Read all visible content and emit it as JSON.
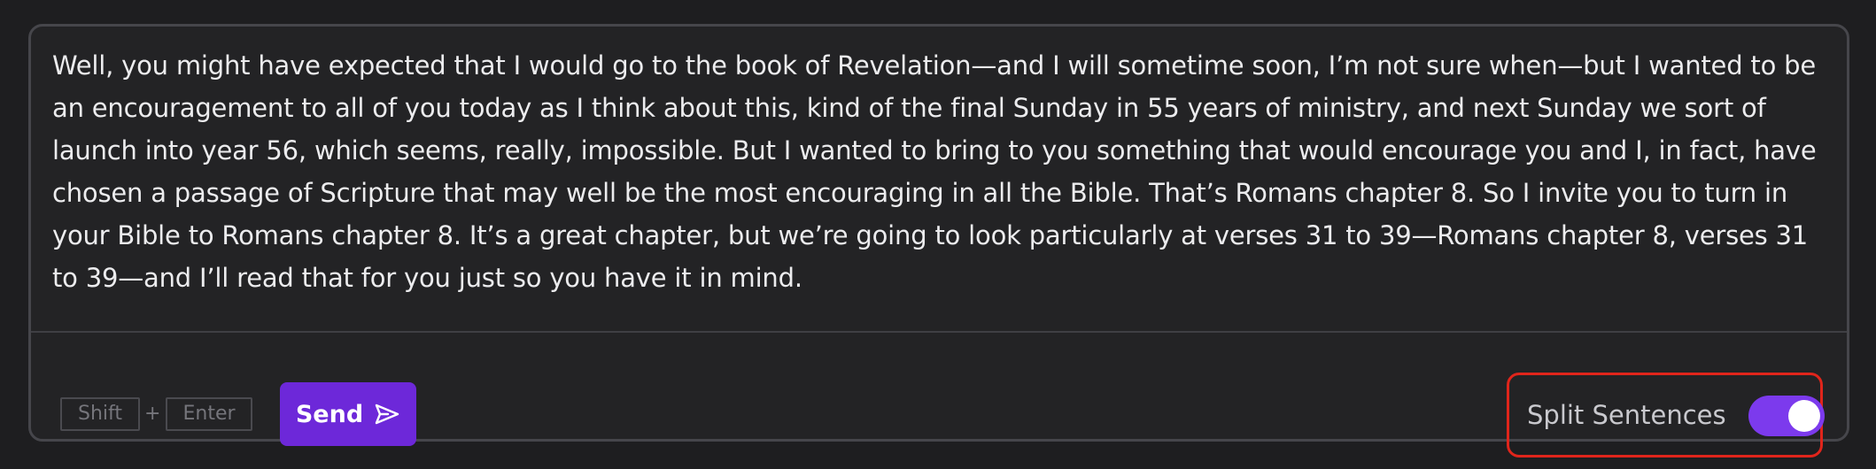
{
  "message": {
    "text": "Well, you might have expected that I would go to the book of Revelation—and I will sometime soon, I’m not sure when—but I wanted to be an encouragement to all of you today as I think about this, kind of the final Sunday in 55 years of ministry, and next Sunday we sort of launch into year 56, which seems, really, impossible. But I wanted to bring to you something that would encourage you and I, in fact, have chosen a passage of Scripture that may well be the most encouraging in all the Bible. That’s Romans chapter 8. So I invite you to turn in your Bible to Romans chapter 8. It’s a great chapter, but we’re going to look particularly at verses 31 to 39—Romans chapter 8, verses 31 to 39—and I’ll read that for you just so you have it in mind."
  },
  "shortcut": {
    "key1": "Shift",
    "plus": "+",
    "key2": "Enter"
  },
  "send": {
    "label": "Send",
    "icon": "send-icon"
  },
  "split_sentences": {
    "label": "Split Sentences",
    "enabled": true
  },
  "colors": {
    "accent": "#6d28d9",
    "toggle_on": "#7c3aed",
    "highlight_border": "#e0251b"
  }
}
